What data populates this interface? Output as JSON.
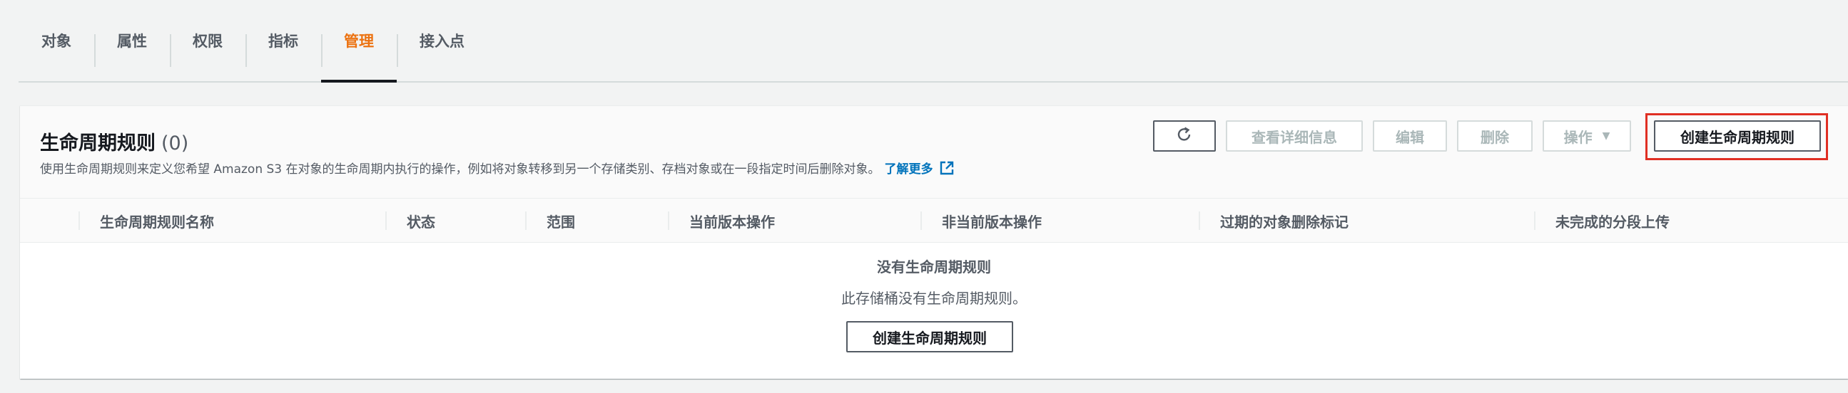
{
  "tabs": [
    {
      "label": "对象"
    },
    {
      "label": "属性"
    },
    {
      "label": "权限"
    },
    {
      "label": "指标"
    },
    {
      "label": "管理",
      "active": true
    },
    {
      "label": "接入点"
    }
  ],
  "panel": {
    "title": "生命周期规则",
    "count": "(0)",
    "description": "使用生命周期规则来定义您希望 Amazon S3 在对象的生命周期内执行的操作，例如将对象转移到另一个存储类别、存档对象或在一段指定时间后删除对象。",
    "learn_more": "了解更多"
  },
  "toolbar": {
    "view_details": "查看详细信息",
    "edit": "编辑",
    "delete": "删除",
    "actions": "操作",
    "create": "创建生命周期规则"
  },
  "table": {
    "columns": [
      "生命周期规则名称",
      "状态",
      "范围",
      "当前版本操作",
      "非当前版本操作",
      "过期的对象删除标记",
      "未完成的分段上传"
    ]
  },
  "empty_state": {
    "title": "没有生命周期规则",
    "description": "此存储桶没有生命周期规则。",
    "create_button": "创建生命周期规则"
  },
  "colors": {
    "active_tab": "#ec7211",
    "link": "#0073bb",
    "highlight": "#e02f23"
  }
}
